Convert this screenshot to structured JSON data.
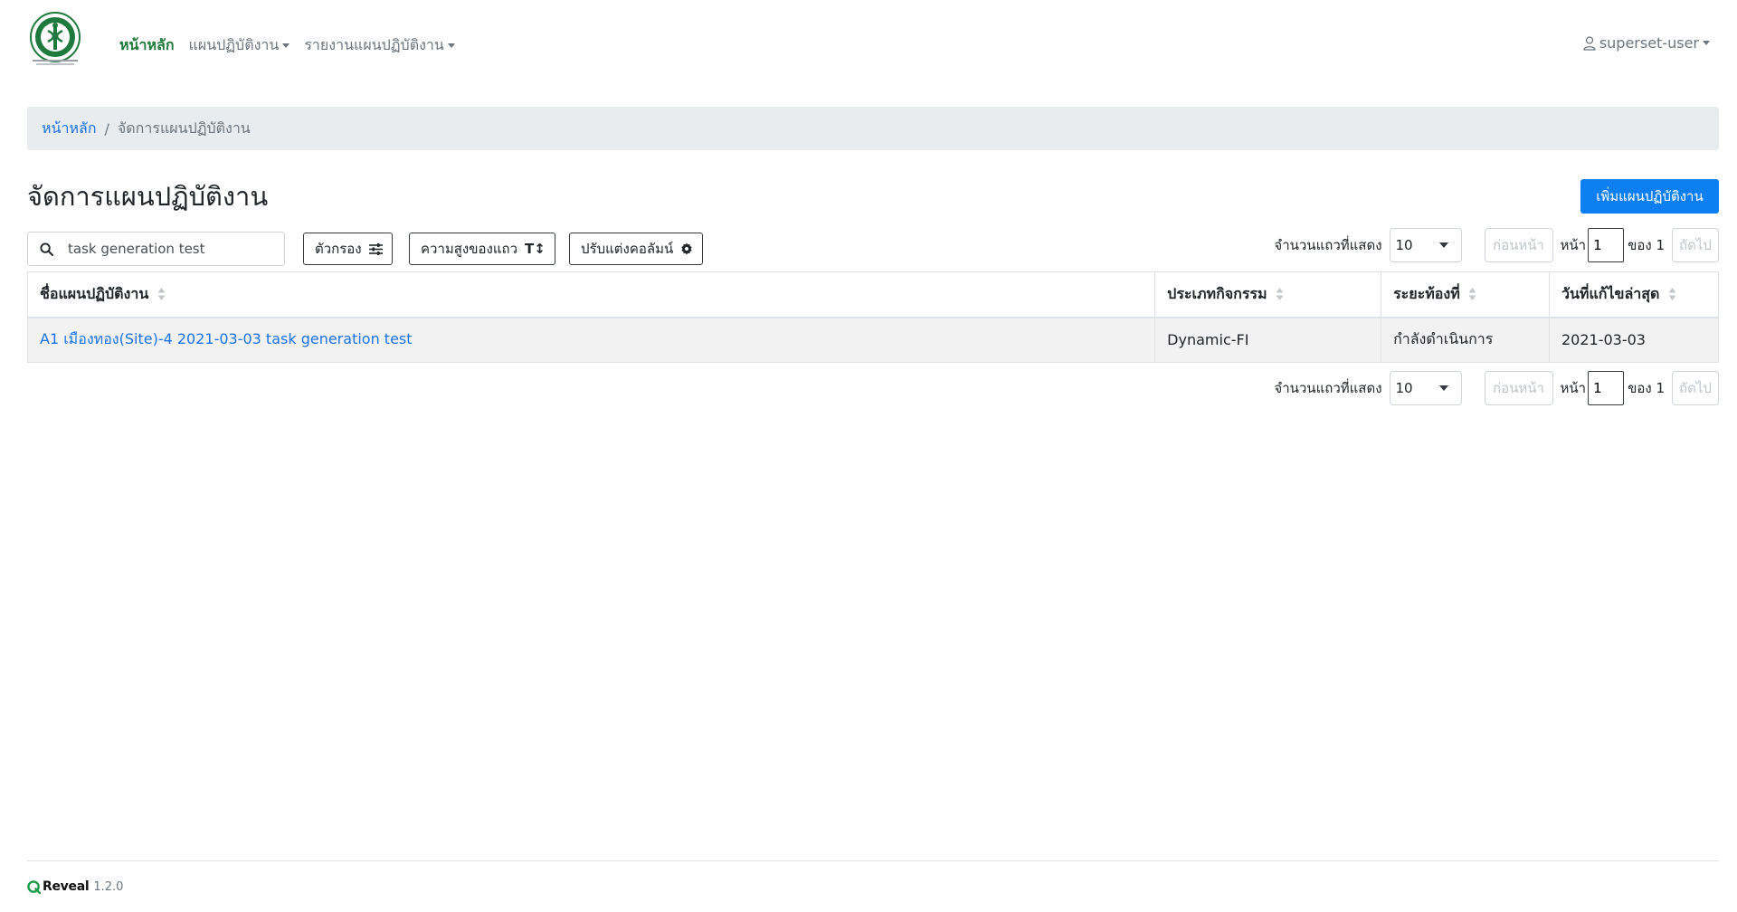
{
  "nav": {
    "links": [
      {
        "label": "หน้าหลัก",
        "active": true
      },
      {
        "label": "แผนปฏิบัติงาน",
        "dropdown": true
      },
      {
        "label": "รายงานแผนปฏิบัติงาน",
        "dropdown": true
      }
    ],
    "user": "superset-user"
  },
  "breadcrumb": {
    "home": "หน้าหลัก",
    "separator": "/",
    "current": "จัดการแผนปฏิบัติงาน"
  },
  "page": {
    "title": "จัดการแผนปฏิบัติงาน",
    "add_button": "เพิ่มแผนปฏิบัติงาน"
  },
  "toolbar": {
    "search_value": "task generation test",
    "filter_button": "ตัวกรอง",
    "row_height_button": "ความสูงของแถว",
    "columns_button": "ปรับแต่งคอลัมน์"
  },
  "pager": {
    "rows_label": "จำนวนแถวที่แสดง",
    "rows_value": "10",
    "prev": "ก่อนหน้า",
    "page_label": "หน้า",
    "page_value": "1",
    "of_label": "ของ 1",
    "next": "ถัดไป"
  },
  "table": {
    "headers": [
      "ชื่อแผนปฏิบัติงาน",
      "ประเภทกิจกรรม",
      "ระยะท้องที่",
      "วันที่แก้ไขล่าสุด"
    ],
    "rows": [
      [
        "A1 เมืองทอง(Site)-4 2021-03-03 task generation test",
        "Dynamic-FI",
        "กำลังดำเนินการ",
        "2021-03-03"
      ]
    ]
  },
  "footer": {
    "brand": "Reveal",
    "version": "1.2.0"
  },
  "colors": {
    "primary": "#0d7ff2",
    "link": "#1a73e8",
    "nav_active": "#1e7a3c"
  }
}
